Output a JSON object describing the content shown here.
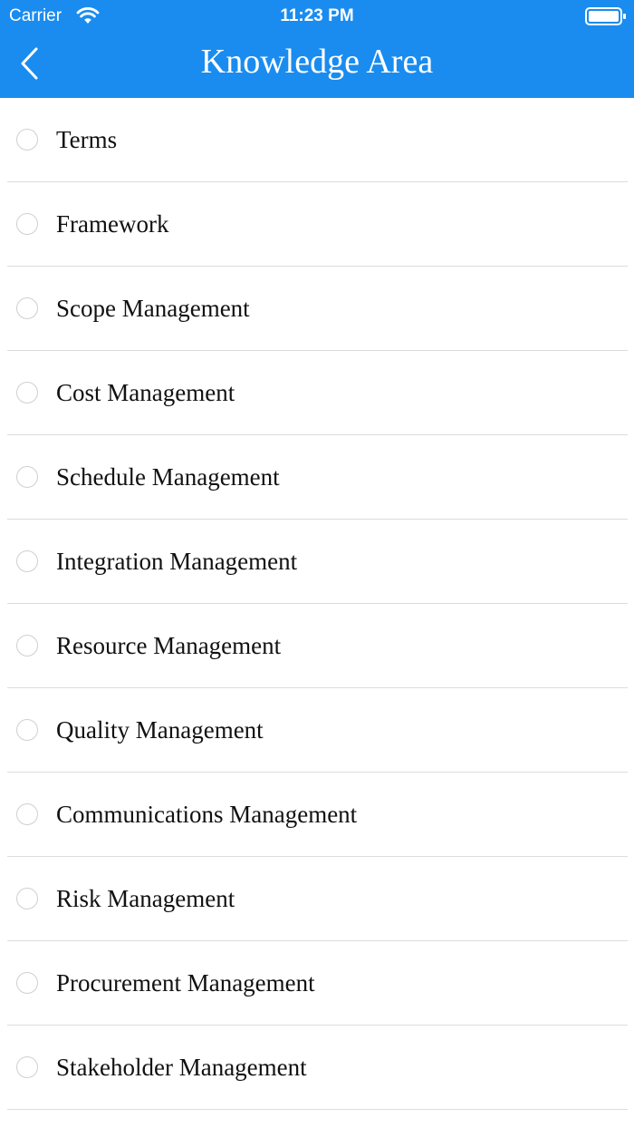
{
  "status_bar": {
    "carrier": "Carrier",
    "time": "11:23 PM"
  },
  "nav": {
    "title": "Knowledge Area"
  },
  "colors": {
    "header": "#1a8cef",
    "divider": "#dcdcdc",
    "radio_border": "#cfcfcf"
  },
  "items": [
    {
      "label": "Terms"
    },
    {
      "label": "Framework"
    },
    {
      "label": "Scope Management"
    },
    {
      "label": "Cost Management"
    },
    {
      "label": "Schedule Management"
    },
    {
      "label": "Integration Management"
    },
    {
      "label": "Resource Management"
    },
    {
      "label": "Quality Management"
    },
    {
      "label": "Communications Management"
    },
    {
      "label": "Risk Management"
    },
    {
      "label": "Procurement Management"
    },
    {
      "label": "Stakeholder Management"
    }
  ]
}
